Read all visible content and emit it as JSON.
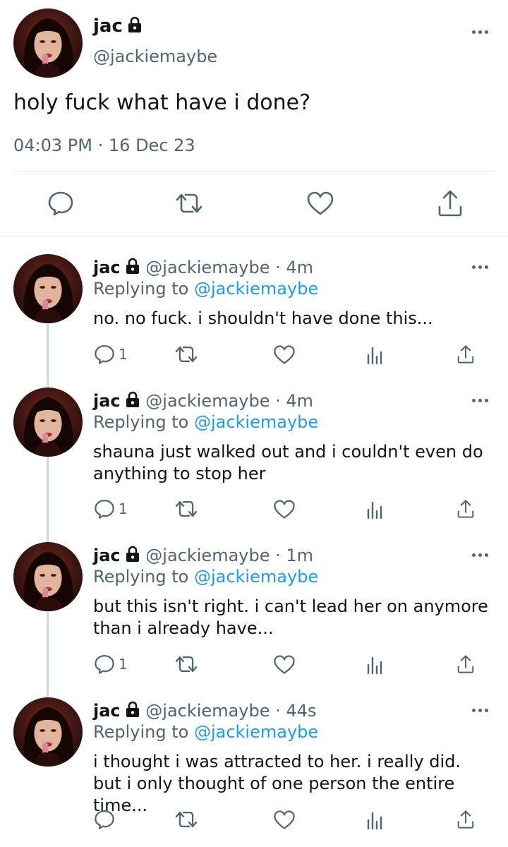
{
  "main_tweet": {
    "name": "jac",
    "handle": "@jackiemaybe",
    "text": "holy fuck what have i done?",
    "time": "04:03 PM",
    "separator": "·",
    "date": "16 Dec 23",
    "icons": [
      "avatar",
      "lock-icon",
      "more-icon",
      "reply-icon",
      "retweet-icon",
      "like-icon",
      "share-icon"
    ]
  },
  "replies": [
    {
      "name": "jac",
      "handle": "@jackiemaybe",
      "time": "· 4m",
      "replying_prefix": "Replying to",
      "replying_to": "@jackiemaybe",
      "text": "no. no fuck. i shouldn't have done this...",
      "reply_count": "1"
    },
    {
      "name": "jac",
      "handle": "@jackiemaybe",
      "time": "· 4m",
      "replying_prefix": "Replying to",
      "replying_to": "@jackiemaybe",
      "text": "shauna just walked out and i couldn't even do anything to stop her",
      "reply_count": "1"
    },
    {
      "name": "jac",
      "handle": "@jackiemaybe",
      "time": "· 1m",
      "replying_prefix": "Replying to",
      "replying_to": "@jackiemaybe",
      "text": "but this isn't right. i can't lead her on anymore than i already have...",
      "reply_count": "1"
    },
    {
      "name": "jac",
      "handle": "@jackiemaybe",
      "time": "· 44s",
      "replying_prefix": "Replying to",
      "replying_to": "@jackiemaybe",
      "text": "i thought i was attracted to her. i really did. but i only thought of one person the entire time...",
      "reply_count": ""
    }
  ],
  "colors": {
    "text": "#0f1419",
    "muted": "#536471",
    "link": "#1d9bf0",
    "divider": "#e6ecf0"
  }
}
